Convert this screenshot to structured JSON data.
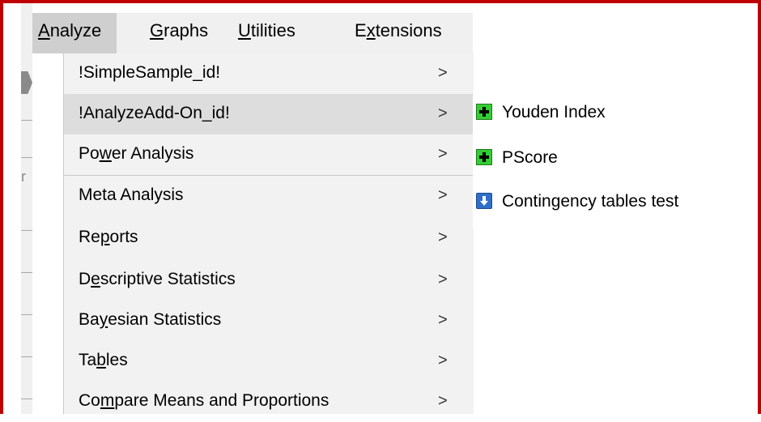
{
  "menubar": {
    "items": [
      {
        "label": "Analyze",
        "mnemonic_index": 0
      },
      {
        "label": "Graphs",
        "mnemonic_index": 0
      },
      {
        "label": "Utilities",
        "mnemonic_index": 0
      },
      {
        "label": "Extensions",
        "mnemonic_index": 1
      }
    ]
  },
  "analyze_menu": {
    "items": [
      {
        "label": "!SimpleSample_id!",
        "mnemonic_index": -1,
        "chevron": ">"
      },
      {
        "label": "!AnalyzeAdd-On_id!",
        "mnemonic_index": -1,
        "chevron": ">",
        "highlighted": true
      },
      {
        "label": "Power Analysis",
        "mnemonic_index": 2,
        "chevron": ">"
      },
      {
        "label": "Meta Analysis",
        "mnemonic_index": -1,
        "chevron": ">"
      },
      {
        "label": "Reports",
        "mnemonic_index": 2,
        "chevron": ">"
      },
      {
        "label": "Descriptive Statistics",
        "mnemonic_index": 1,
        "chevron": ">"
      },
      {
        "label": "Bayesian Statistics",
        "mnemonic_index": 2,
        "chevron": ">"
      },
      {
        "label": "Tables",
        "mnemonic_index": 2,
        "chevron": ">"
      },
      {
        "label": "Compare Means and Proportions",
        "mnemonic_index": 2,
        "chevron": ">"
      }
    ]
  },
  "submenu": {
    "items": [
      {
        "label": "Youden Index",
        "icon": "green-plus-icon"
      },
      {
        "label": "PScore",
        "icon": "green-plus-icon"
      },
      {
        "label": "Contingency tables test",
        "icon": "blue-download-icon"
      }
    ]
  },
  "colors": {
    "frame": "#c00000",
    "menubar_bg": "#f0f0f0",
    "menubar_active": "#cfcfcf",
    "menu_bg": "#f2f2f2",
    "menu_highlight": "#dddddd",
    "plus_icon": "#32cd32",
    "download_icon": "#2f6fc9"
  }
}
